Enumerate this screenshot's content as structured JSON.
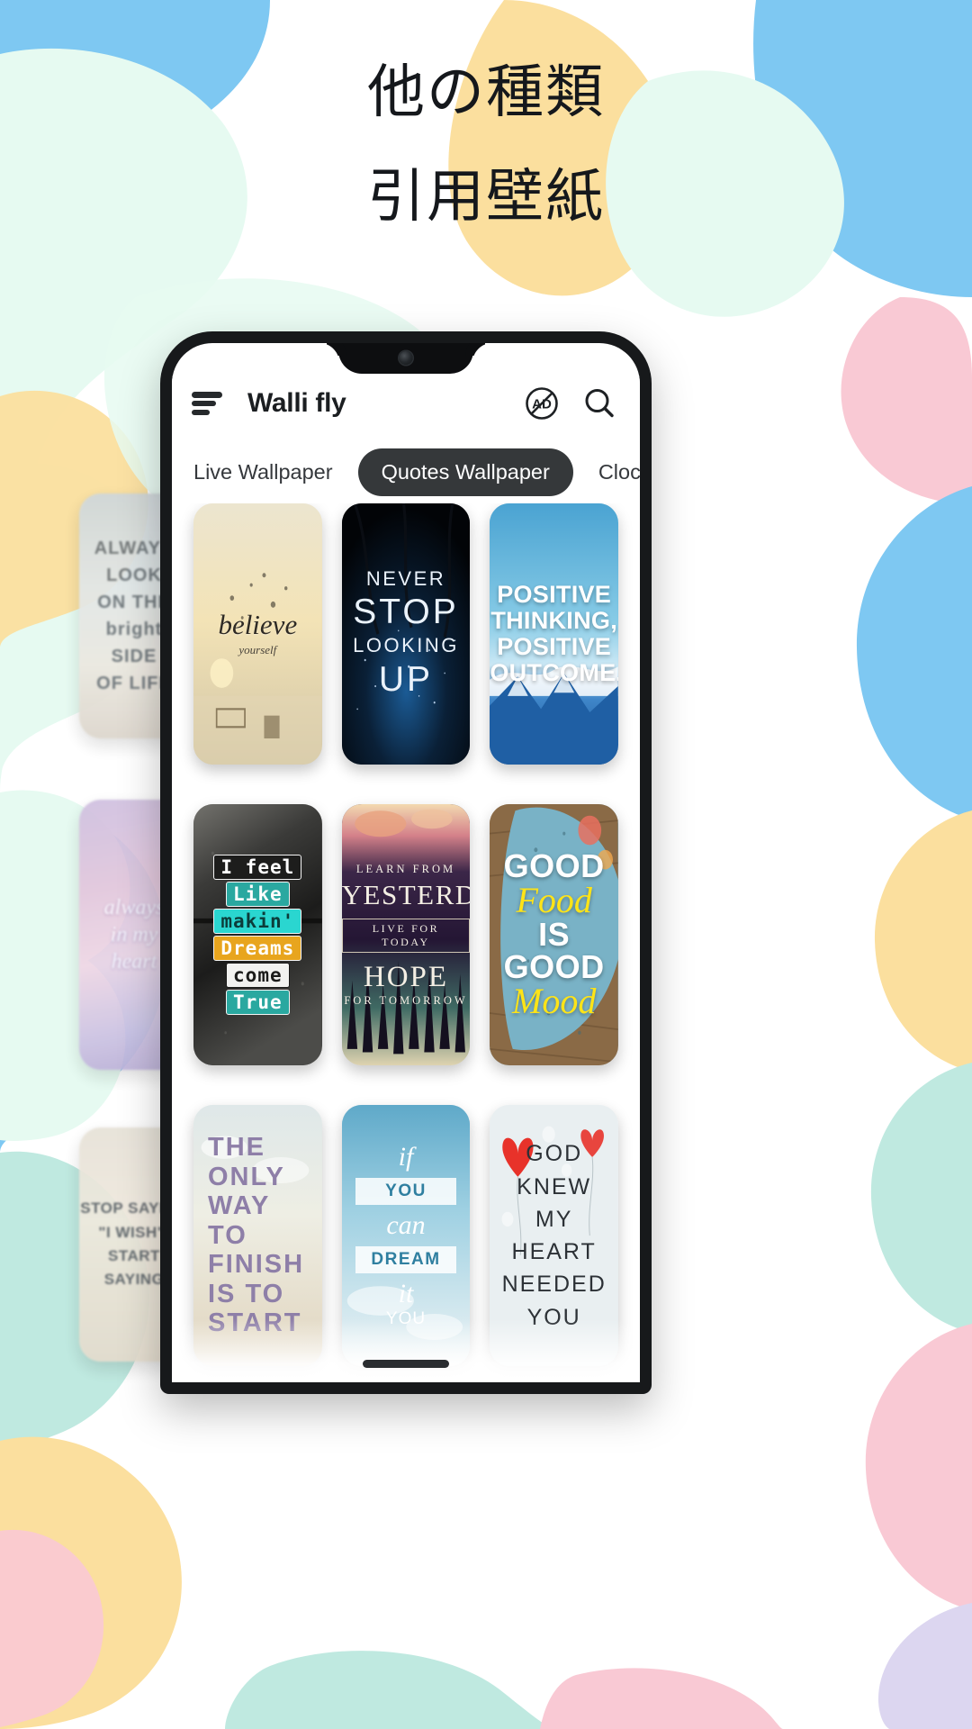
{
  "headline": {
    "line1": "他の種類",
    "line2": "引用壁紙"
  },
  "colors": {
    "blob_blue": "#7ec8f2",
    "blob_mint": "#e6faf1",
    "blob_yellow": "#fbdf9e",
    "blob_pink": "#f9c9d4",
    "blob_teal": "#bfe9e0",
    "blob_lavender": "#dcd6f0",
    "accent_dark": "#35383a",
    "text_dark": "#15181c"
  },
  "phone": {
    "appbar": {
      "menu_icon": "hamburger-menu-icon",
      "title": "Walli fly",
      "ad_icon": "no-ads-icon",
      "ad_label": "AD",
      "search_icon": "search-icon"
    },
    "tabs": [
      {
        "label": "Live Wallpaper",
        "active": false
      },
      {
        "label": "Quotes Wallpaper",
        "active": true
      },
      {
        "label": "Clock Wa",
        "active": false
      }
    ],
    "wallpapers": [
      {
        "id": "believe",
        "line1": "believe",
        "line2": "yourself",
        "style": "sunset-field"
      },
      {
        "id": "never-stop-looking-up",
        "line1": "NEVER",
        "line2": "STOP",
        "line3": "LOOKING",
        "line4": "UP",
        "style": "starry-night"
      },
      {
        "id": "positive-thinking",
        "line1": "POSITIVE",
        "line2": "THINKING,",
        "line3": "POSITIVE",
        "line4": "OUTCOME.",
        "style": "blue-mountain"
      },
      {
        "id": "i-feel-like-makin-dreams-come-true",
        "line1": "I feel",
        "line2": "Like",
        "line3": "makin'",
        "line4": "Dreams",
        "line5": "come",
        "line6": "True",
        "style": "dark-concrete"
      },
      {
        "id": "learn-from-yesterday",
        "line1": "LEARN FROM",
        "line2": "YESTERDAY",
        "line3": "LIVE FOR TODAY",
        "line4": "HOPE",
        "line5": "FOR TOMORROW",
        "style": "purple-forest"
      },
      {
        "id": "good-food-is-good-mood",
        "line1": "GOOD",
        "line2": "Food",
        "line3": "IS GOOD",
        "line4": "Mood",
        "style": "wood-table"
      },
      {
        "id": "the-only-way-to-finish-is-to-start",
        "line1": "THE",
        "line2": "ONLY",
        "line3": "WAY TO",
        "line4": "FINISH",
        "line5": "IS TO",
        "line6": "START",
        "style": "pastel-sky"
      },
      {
        "id": "if-you-can-dream-it-you",
        "line1": "if",
        "line2": "YOU",
        "line3": "can",
        "line4": "DREAM",
        "line5": "it",
        "line6": "YOU",
        "style": "blue-sky-banner"
      },
      {
        "id": "god-knew-my-heart-needed-you",
        "line1": "GOD KNEW",
        "line2": "MY HEART",
        "line3": "NEEDED YOU",
        "style": "balloon-hearts"
      }
    ],
    "side_peek": [
      {
        "id": "always-look-on-the-bright-side-of-life",
        "line1": "ALWAYS",
        "line2": "LOOK",
        "line3": "ON THE",
        "line4": "bright",
        "line5": "SIDE",
        "line6": "OF LIFE"
      },
      {
        "id": "always-in-my-heart",
        "line1": "always",
        "line2": "in my",
        "line3": "heart"
      },
      {
        "id": "stop-saying-i-wish-start-saying",
        "line1": "STOP SAYING",
        "line2": "\"I WISH\",",
        "line3": "START SAYING"
      }
    ],
    "home_indicator": "home-indicator"
  }
}
